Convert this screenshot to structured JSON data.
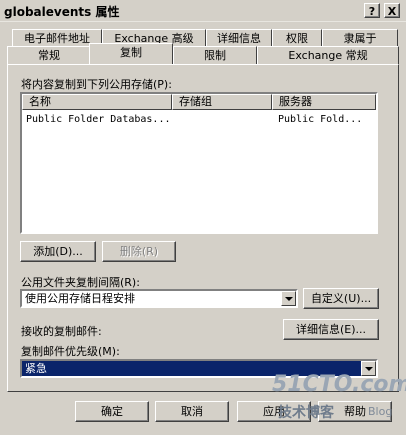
{
  "window": {
    "title": "globalevents 属性",
    "help_btn": "?",
    "close_btn": "X"
  },
  "tabs_row1": [
    "电子邮件地址",
    "Exchange 高级",
    "详细信息",
    "权限",
    "隶属于"
  ],
  "tabs_row2": [
    "常规",
    "复制",
    "限制",
    "Exchange 常规"
  ],
  "replicate_label": "将内容复制到下列公用存储(P):",
  "list": {
    "columns": [
      "名称",
      "存储组",
      "服务器"
    ],
    "rows": [
      {
        "name": "Public Folder Databas...",
        "storage_group": "",
        "server": "Public Fold..."
      }
    ]
  },
  "buttons": {
    "add": "添加(D)...",
    "remove": "删除(R)",
    "customize": "自定义(U)...",
    "details": "详细信息(E)...",
    "ok": "确定",
    "cancel": "取消",
    "apply": "应用",
    "help": "帮助"
  },
  "interval_label": "公用文件夹复制间隔(R):",
  "interval_value": "使用公用存储日程安排",
  "received_label": "接收的复制邮件:",
  "priority_label": "复制邮件优先级(M):",
  "priority_value": "紧急",
  "watermark": {
    "main": "51CTO.com",
    "sub": "技术博客",
    "blog": "Blog"
  }
}
